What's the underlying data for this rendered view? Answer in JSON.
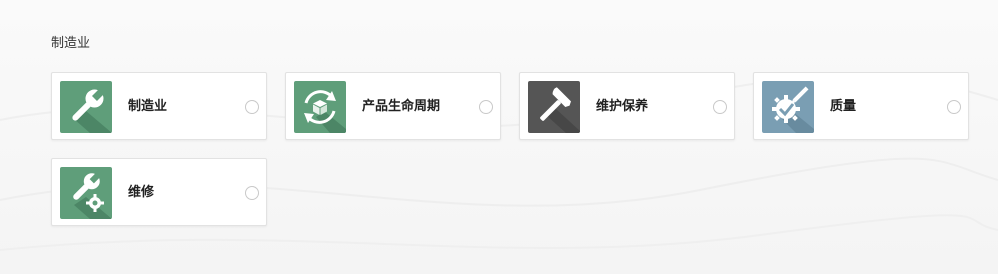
{
  "section": {
    "title": "制造业"
  },
  "cards": [
    {
      "label": "制造业",
      "icon": "wrench-icon",
      "color": "#5f9e7a"
    },
    {
      "label": "产品生命周期",
      "icon": "lifecycle-box-icon",
      "color": "#5f9e7a"
    },
    {
      "label": "维护保养",
      "icon": "hammer-icon",
      "color": "#555555"
    },
    {
      "label": "质量",
      "icon": "quality-gear-check-icon",
      "color": "#7a9eb3"
    },
    {
      "label": "维修",
      "icon": "wrench-gear-icon",
      "color": "#5f9e7a"
    }
  ]
}
